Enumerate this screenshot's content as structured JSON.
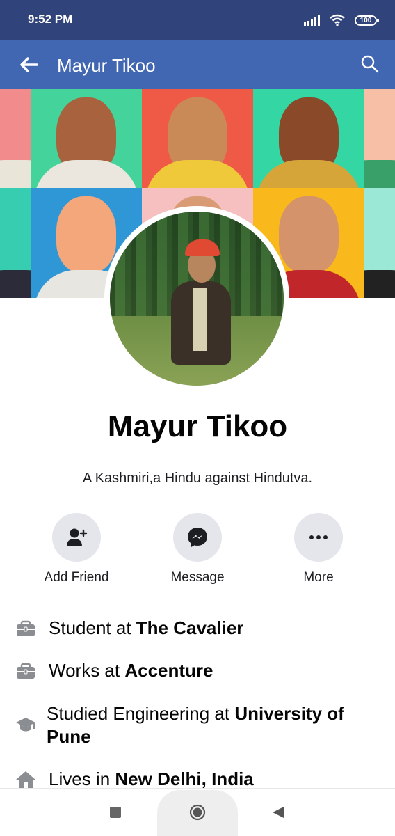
{
  "status_bar": {
    "time": "9:52 PM",
    "battery": "100"
  },
  "app_bar": {
    "title": "Mayur Tikoo"
  },
  "profile": {
    "name": "Mayur Tikoo",
    "bio": "A Kashmiri,a Hindu against Hindutva."
  },
  "actions": [
    {
      "label": "Add Friend",
      "icon": "add-friend-icon"
    },
    {
      "label": "Message",
      "icon": "messenger-icon"
    },
    {
      "label": "More",
      "icon": "more-icon"
    }
  ],
  "info": [
    {
      "prefix": "Student at ",
      "bold": "The Cavalier",
      "icon": "briefcase-icon"
    },
    {
      "prefix": "Works at ",
      "bold": "Accenture",
      "icon": "briefcase-icon"
    },
    {
      "prefix": "Studied Engineering at ",
      "bold": "University of Pune",
      "icon": "graduation-cap-icon"
    },
    {
      "prefix": "Lives in ",
      "bold": "New Delhi, India",
      "icon": "home-icon"
    }
  ],
  "colors": {
    "status_bar": "#30437a",
    "app_bar": "#4267b2",
    "action_circle": "#e4e6eb",
    "icon_gray": "#8a8d91"
  }
}
